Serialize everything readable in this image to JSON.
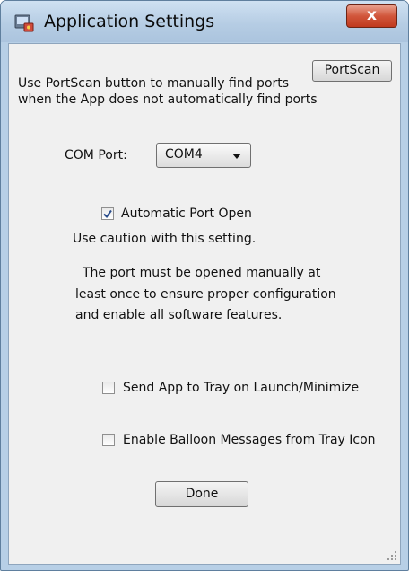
{
  "window": {
    "title": "Application Settings",
    "close_label": "x"
  },
  "content": {
    "portscan_hint_line1": "Use PortScan button to manually find ports",
    "portscan_hint_line2": "when the App does not automatically find ports",
    "portscan_button": "PortScan",
    "com_port_label": "COM Port:",
    "com_port_value": "COM4",
    "auto_open": {
      "label": "Automatic Port Open",
      "checked": true
    },
    "caution_text": "Use caution with this setting.",
    "note_line1": "The port must be opened manually at",
    "note_line2": "least once to ensure proper configuration",
    "note_line3": "and enable all software features.",
    "tray_launch": {
      "label": "Send App to Tray on Launch/Minimize",
      "checked": false
    },
    "balloon_messages": {
      "label": "Enable Balloon Messages from Tray Icon",
      "checked": false
    },
    "done_button": "Done"
  }
}
